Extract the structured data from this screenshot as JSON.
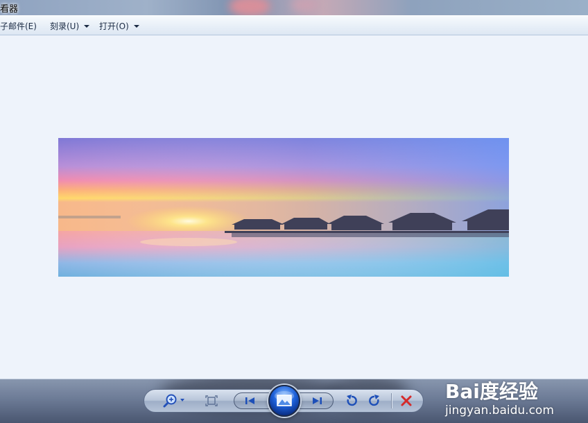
{
  "window": {
    "title": "看器"
  },
  "menu": {
    "items": [
      {
        "label": "子邮件(E)",
        "has_dropdown": false
      },
      {
        "label": "刻录(U)",
        "has_dropdown": true
      },
      {
        "label": "打开(O)",
        "has_dropdown": true
      }
    ]
  },
  "viewer": {
    "image_description_icon": "sunset-overwater-villas-photo",
    "background": "#eef3fb"
  },
  "controls": {
    "zoom": {
      "icon": "zoom-icon",
      "has_dropdown": true
    },
    "actual_size": {
      "icon": "actual-size-icon"
    },
    "previous": {
      "icon": "previous-icon"
    },
    "slideshow": {
      "icon": "slideshow-icon"
    },
    "next": {
      "icon": "next-icon"
    },
    "rotate_ccw": {
      "icon": "rotate-counterclockwise-icon"
    },
    "rotate_cw": {
      "icon": "rotate-clockwise-icon"
    },
    "delete": {
      "icon": "delete-icon",
      "color": "#d52a2a"
    }
  },
  "watermark": {
    "brand": "Bai度经验",
    "url": "jingyan.baidu.com"
  }
}
